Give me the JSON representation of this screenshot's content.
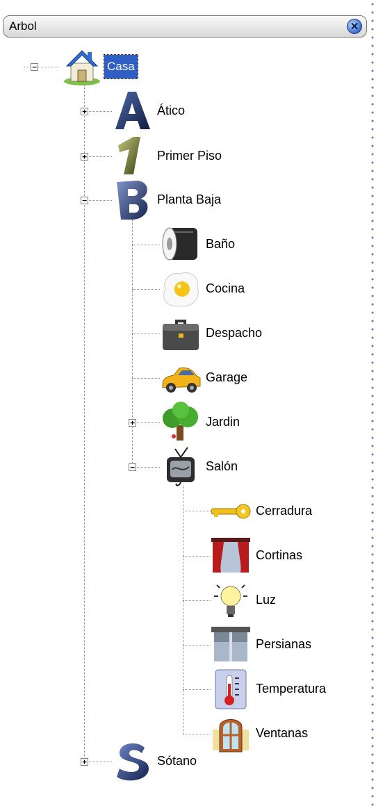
{
  "panel": {
    "title": "Arbol",
    "close_symbol": "✕"
  },
  "tree": {
    "root": {
      "label": "Casa",
      "icon": "house-icon",
      "expander": "−",
      "selected": true
    },
    "floors": [
      {
        "label": "Ático",
        "icon": "letter-a-icon",
        "expander": "+"
      },
      {
        "label": "Primer Piso",
        "icon": "number-one-icon",
        "expander": "+"
      },
      {
        "label": "Planta Baja",
        "icon": "letter-b-icon",
        "expander": "−"
      },
      {
        "label": "Sótano",
        "icon": "letter-s-icon",
        "expander": "+"
      }
    ],
    "rooms": [
      {
        "label": "Baño",
        "icon": "toilet-paper-icon"
      },
      {
        "label": "Cocina",
        "icon": "fried-egg-icon"
      },
      {
        "label": "Despacho",
        "icon": "briefcase-icon"
      },
      {
        "label": "Garage",
        "icon": "car-icon"
      },
      {
        "label": "Jardin",
        "icon": "tree-icon",
        "expander": "+"
      },
      {
        "label": "Salón",
        "icon": "television-icon",
        "expander": "−"
      }
    ],
    "devices": [
      {
        "label": "Cerradura",
        "icon": "key-icon"
      },
      {
        "label": "Cortinas",
        "icon": "curtains-icon"
      },
      {
        "label": "Luz",
        "icon": "light-bulb-icon"
      },
      {
        "label": "Persianas",
        "icon": "blinds-icon"
      },
      {
        "label": "Temperatura",
        "icon": "thermometer-icon"
      },
      {
        "label": "Ventanas",
        "icon": "window-icon"
      }
    ]
  }
}
